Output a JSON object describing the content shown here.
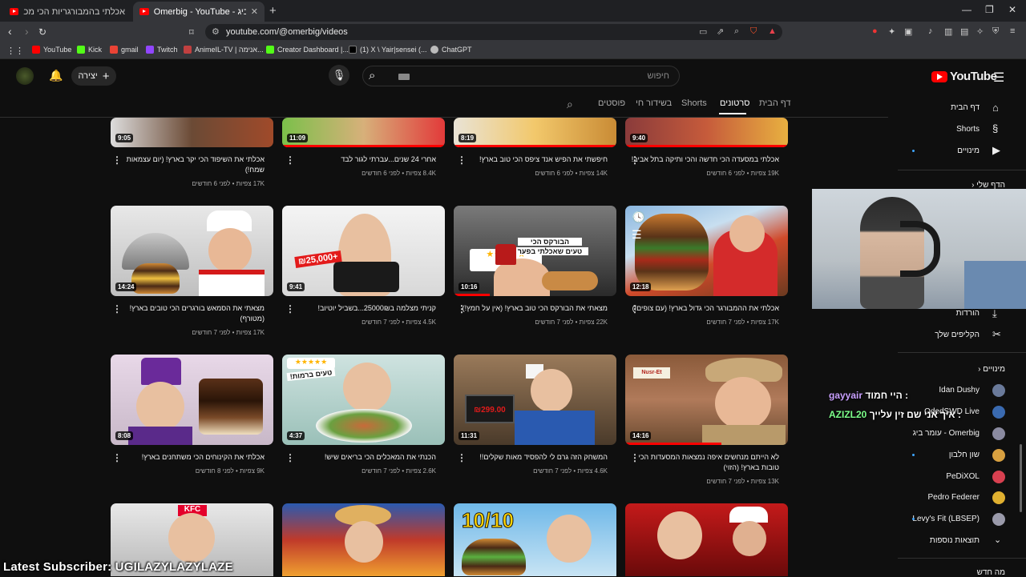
{
  "browser": {
    "tabs": [
      {
        "title": "אכלתי בהמבורגריות הכי מכבטיחות בי..."
      },
      {
        "title": "Omerbig - YouTube - עומר ביג"
      }
    ],
    "new_tab": "+",
    "url": "youtube.com/@omerbig/videos",
    "bookmarks": [
      "YouTube",
      "Kick",
      "gmail",
      "Twitch",
      "AnimeIL-TV | אנימה...",
      "Creator Dashboard |...",
      "(1) X \\ Yair|sensei (...",
      "ChatGPT"
    ],
    "colors": {
      "tabbar": "#1f2023",
      "toolbar": "#35363a",
      "accent": "#ff0000"
    }
  },
  "header": {
    "logo_text": "YouTube",
    "search_placeholder": "חיפוש",
    "create_label": "יצירה",
    "icons": [
      "menu-icon",
      "search-icon",
      "mic-icon",
      "bell-icon",
      "plus-icon"
    ]
  },
  "channel_tabs": {
    "home": "דף הבית",
    "videos": "סרטונים",
    "shorts": "Shorts",
    "live": "בשידור חי",
    "posts": "פוסטים"
  },
  "videos": [
    {
      "title": "אכלתי במסעדה הכי חדשה והכי ותיקה בתל אביב!",
      "views": "19K צפיות",
      "age": "לפני 6 חודשים",
      "duration": "9:40"
    },
    {
      "title": "חיפשתי את הפיש אנד ציפס הכי טוב בארץ!",
      "views": "14K צפיות",
      "age": "לפני 6 חודשים",
      "duration": "8:19"
    },
    {
      "title": "אחרי 24 שנים...עברתי לגור לבד",
      "views": "8.4K צפיות",
      "age": "לפני 6 חודשים",
      "duration": "11:09"
    },
    {
      "title": "אכלתי את השיפוד הכי יקר בארץ! (יום עצמאות שמח!)",
      "views": "17K צפיות",
      "age": "לפני 6 חודשים",
      "duration": "9:05"
    },
    {
      "title": "אכלתי את ההמבורגר הכי גדול בארץ! (עם צופים!)",
      "views": "17K צפיות",
      "age": "לפני 7 חודשים",
      "duration": "12:18"
    },
    {
      "title": "מצאתי את הבורקס הכי טוב בארץ! (אין על חמץ!)",
      "views": "22K צפיות",
      "age": "לפני 7 חודשים",
      "duration": "10:16"
    },
    {
      "title": "קניתי מצלמה ב25000₪...בשביל יוטיוב!",
      "views": "4.5K צפיות",
      "age": "לפני 7 חודשים",
      "duration": "9:41"
    },
    {
      "title": "מצאתי את הסמאש בורגרים הכי טובים בארץ! (מטורף)",
      "views": "17K צפיות",
      "age": "לפני 7 חודשים",
      "duration": "14:24"
    },
    {
      "title": "לא הייתם מנחשים איפה נמצאות המסעדות הכי טובות בארץ! (הזוי)",
      "views": "13K צפיות",
      "age": "לפני 7 חודשים",
      "duration": "14:16"
    },
    {
      "title": "המשחק הזה גרם לי להפסיד מאות שקלים!!",
      "views": "4.6K צפיות",
      "age": "לפני 7 חודשים",
      "duration": "11:31"
    },
    {
      "title": "הכנתי את המאכלים הכי בריאים שיש!",
      "views": "2.6K צפיות",
      "age": "לפני 7 חודשים",
      "duration": "4:37"
    },
    {
      "title": "אכלתי את הקינוחים הכי משתחנים בארץ!",
      "views": "9K צפיות",
      "age": "לפני 8 חודשים",
      "duration": "8:08"
    }
  ],
  "thumb_text": {
    "borekas_line1": "הבורקס הכי",
    "borekas_line2": "טעים שאכלתי בפער",
    "camera_price": "₪25,000+",
    "rating": "10/10",
    "healthy": "טעים ברמות!",
    "price_tag": "₪299.00",
    "kfc": "KFC",
    "nusret": "Nusr-Et"
  },
  "sidebar": {
    "home": "דף הבית",
    "shorts": "Shorts",
    "subscriptions": "מינויים",
    "you": "הדף שלי",
    "downloads": "הורדות",
    "clips": "הקליפים שלך",
    "subs_header": "מינויים",
    "channels": [
      "Idan Dushy",
      "OdedSWD Live",
      "עומר ביג - Omerbig",
      "שון חלבון",
      "PeDiXOL",
      "Pedro Federer",
      "Levy's Fit (LBSEP)"
    ],
    "show_more": "תוצאות נוספות",
    "explore": "מה חדש"
  },
  "stream_overlay": {
    "chat": [
      {
        "user": "gayyair",
        "message": "היי חמוד :"
      },
      {
        "user": "AZIZL20",
        "message": "איך אני שם זין עלייך :"
      }
    ],
    "latest_subscriber": "Latest Subscriber: UGILAZYLAZYLAZE"
  }
}
